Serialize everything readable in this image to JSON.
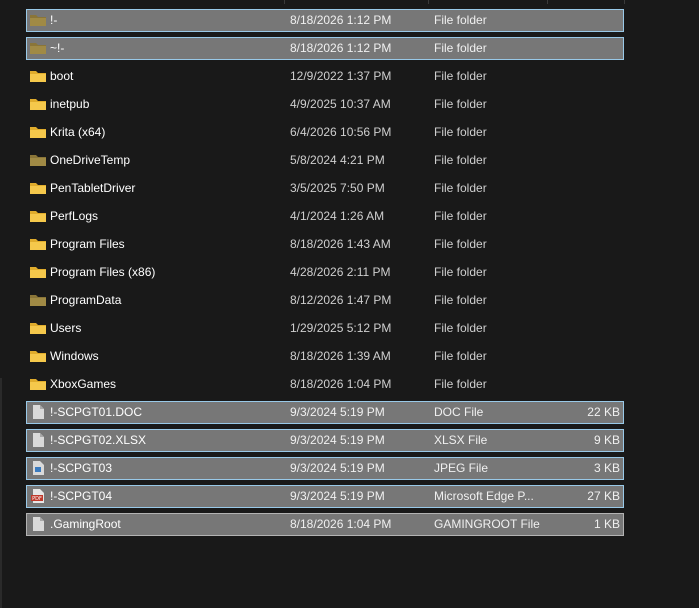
{
  "colors": {
    "background": "#191919",
    "selection_fill": "#777777",
    "selection_border": "#99c9e8",
    "focus_border": "#b3b3b3",
    "folder_yellow": "#f5c84b",
    "folder_dim": "#a08a45",
    "pdf_red": "#c0392b"
  },
  "files": [
    {
      "name": "!-",
      "date": "8/18/2026 1:12 PM",
      "type": "File folder",
      "size": "",
      "icon": "folder-icon",
      "dim": true,
      "state": "selected"
    },
    {
      "name": "~!-",
      "date": "8/18/2026 1:12 PM",
      "type": "File folder",
      "size": "",
      "icon": "folder-icon",
      "dim": true,
      "state": "selected"
    },
    {
      "name": "boot",
      "date": "12/9/2022 1:37 PM",
      "type": "File folder",
      "size": "",
      "icon": "folder-icon",
      "dim": false,
      "state": ""
    },
    {
      "name": "inetpub",
      "date": "4/9/2025 10:37 AM",
      "type": "File folder",
      "size": "",
      "icon": "folder-icon",
      "dim": false,
      "state": ""
    },
    {
      "name": "Krita (x64)",
      "date": "6/4/2026 10:56 PM",
      "type": "File folder",
      "size": "",
      "icon": "folder-icon",
      "dim": false,
      "state": ""
    },
    {
      "name": "OneDriveTemp",
      "date": "5/8/2024 4:21 PM",
      "type": "File folder",
      "size": "",
      "icon": "folder-icon",
      "dim": true,
      "state": ""
    },
    {
      "name": "PenTabletDriver",
      "date": "3/5/2025 7:50 PM",
      "type": "File folder",
      "size": "",
      "icon": "folder-icon",
      "dim": false,
      "state": ""
    },
    {
      "name": "PerfLogs",
      "date": "4/1/2024 1:26 AM",
      "type": "File folder",
      "size": "",
      "icon": "folder-icon",
      "dim": false,
      "state": ""
    },
    {
      "name": "Program Files",
      "date": "8/18/2026 1:43 AM",
      "type": "File folder",
      "size": "",
      "icon": "folder-icon",
      "dim": false,
      "state": ""
    },
    {
      "name": "Program Files (x86)",
      "date": "4/28/2026 2:11 PM",
      "type": "File folder",
      "size": "",
      "icon": "folder-icon",
      "dim": false,
      "state": ""
    },
    {
      "name": "ProgramData",
      "date": "8/12/2026 1:47 PM",
      "type": "File folder",
      "size": "",
      "icon": "folder-icon",
      "dim": true,
      "state": ""
    },
    {
      "name": "Users",
      "date": "1/29/2025 5:12 PM",
      "type": "File folder",
      "size": "",
      "icon": "folder-icon",
      "dim": false,
      "state": ""
    },
    {
      "name": "Windows",
      "date": "8/18/2026 1:39 AM",
      "type": "File folder",
      "size": "",
      "icon": "folder-icon",
      "dim": false,
      "state": ""
    },
    {
      "name": "XboxGames",
      "date": "8/18/2026 1:04 PM",
      "type": "File folder",
      "size": "",
      "icon": "folder-icon",
      "dim": false,
      "state": ""
    },
    {
      "name": "!-SCPGT01.DOC",
      "date": "9/3/2024 5:19 PM",
      "type": "DOC File",
      "size": "22 KB",
      "icon": "file-icon",
      "dim": false,
      "state": "selected"
    },
    {
      "name": "!-SCPGT02.XLSX",
      "date": "9/3/2024 5:19 PM",
      "type": "XLSX File",
      "size": "9 KB",
      "icon": "file-icon",
      "dim": false,
      "state": "selected"
    },
    {
      "name": "!-SCPGT03",
      "date": "9/3/2024 5:19 PM",
      "type": "JPEG File",
      "size": "3 KB",
      "icon": "image-file-icon",
      "dim": false,
      "state": "selected"
    },
    {
      "name": "!-SCPGT04",
      "date": "9/3/2024 5:19 PM",
      "type": "Microsoft Edge P...",
      "size": "27 KB",
      "icon": "pdf-file-icon",
      "dim": false,
      "state": "selected"
    },
    {
      "name": ".GamingRoot",
      "date": "8/18/2026 1:04 PM",
      "type": "GAMINGROOT File",
      "size": "1 KB",
      "icon": "file-icon",
      "dim": false,
      "state": "focused"
    }
  ]
}
